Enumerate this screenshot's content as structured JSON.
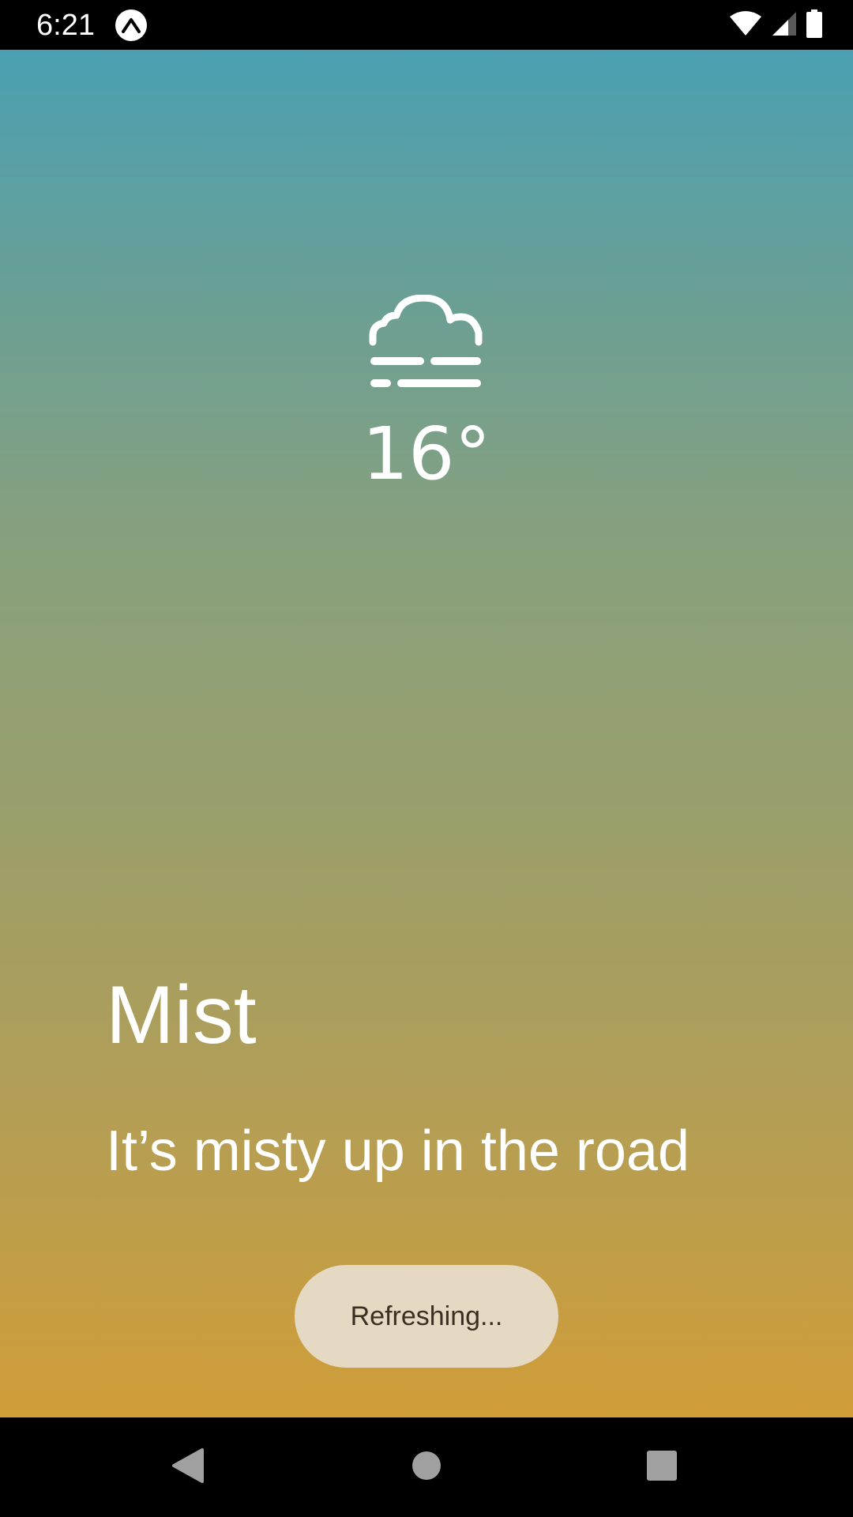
{
  "status_bar": {
    "time": "6:21",
    "app_icon": "expo-icon",
    "icons": [
      "wifi-icon",
      "cell-signal-icon",
      "battery-icon"
    ]
  },
  "weather": {
    "icon": "mist-icon",
    "temperature": "16°",
    "condition": "Mist",
    "description": "It’s misty up in the road"
  },
  "toast": {
    "text": "Refreshing..."
  },
  "nav_bar": {
    "buttons": [
      "back-icon",
      "home-icon",
      "recents-icon"
    ]
  },
  "colors": {
    "gradient_top": "#4aa0b2",
    "gradient_bottom": "#d09d38",
    "toast_bg": "#e5d9c4"
  }
}
